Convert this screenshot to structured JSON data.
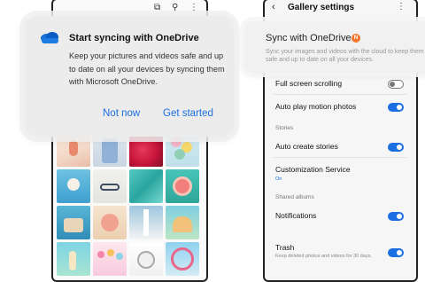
{
  "left": {
    "card": {
      "title": "Start syncing with OneDrive",
      "body": "Keep your pictures and videos safe and up to date on all your devices by syncing them with Microsoft OneDrive.",
      "not_now": "Not now",
      "get_started": "Get started"
    },
    "topbar_icons": [
      "cast-icon",
      "search-icon",
      "more-icon"
    ]
  },
  "right": {
    "header": {
      "title": "Gallery settings"
    },
    "banner": {
      "title": "Sync with OneDrive",
      "badge": "N",
      "desc": "Sync your images and videos with the cloud to keep them safe and up to date on all your devices."
    },
    "rows": {
      "full_screen": "Full screen scrolling",
      "auto_play": "Auto play motion photos",
      "stories_section": "Stories",
      "auto_create": "Auto create stories",
      "customization": "Customization Service",
      "customization_state": "On",
      "shared_section": "Shared albums",
      "notifications": "Notifications",
      "trash": "Trash",
      "trash_desc": "Keep deleted photos and videos for 30 days."
    },
    "toggles": {
      "full_screen": false,
      "auto_play": true,
      "auto_create": true,
      "notifications": true,
      "trash": true
    }
  },
  "colors": {
    "accent": "#1b6fe0",
    "badge": "#f5762a"
  }
}
